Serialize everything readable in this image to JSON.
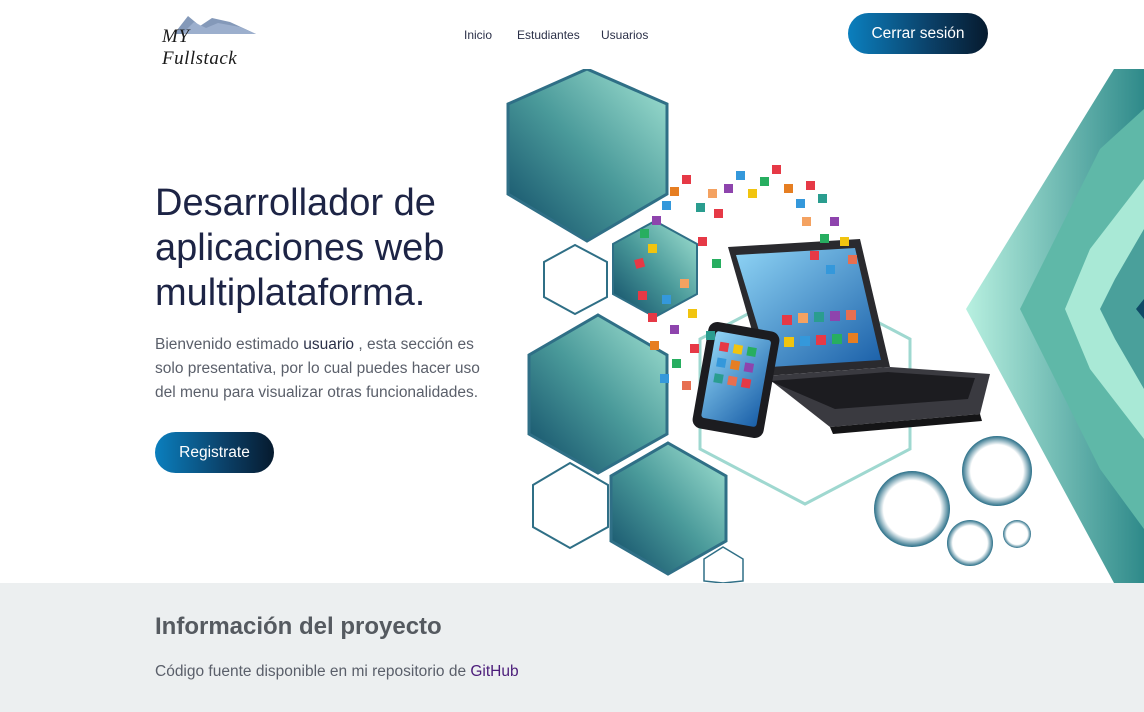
{
  "header": {
    "logo_text": "MY Fullstack",
    "nav": [
      {
        "label": "Inicio"
      },
      {
        "label": "Estudiantes"
      },
      {
        "label": "Usuarios"
      }
    ],
    "logout_label": "Cerrar sesión"
  },
  "hero": {
    "title": "Desarrollador de aplicaciones web multiplataforma.",
    "desc_before": "Bienvenido estimado",
    "desc_user": "usuario",
    "desc_after": ", esta sección es solo presentativa, por lo cual puedes hacer uso del menu para visualizar otras funcionalidades.",
    "register_label": "Registrate"
  },
  "info": {
    "title": "Información del proyecto",
    "text_before": "Código fuente disponible en mi repositorio de",
    "link_label": "GitHub"
  },
  "colors": {
    "accent_dark": "#1d2445",
    "button_start": "#0b7fbe",
    "button_end": "#061a2e",
    "teal": "#5fb8a8",
    "link": "#4b1c7a"
  }
}
